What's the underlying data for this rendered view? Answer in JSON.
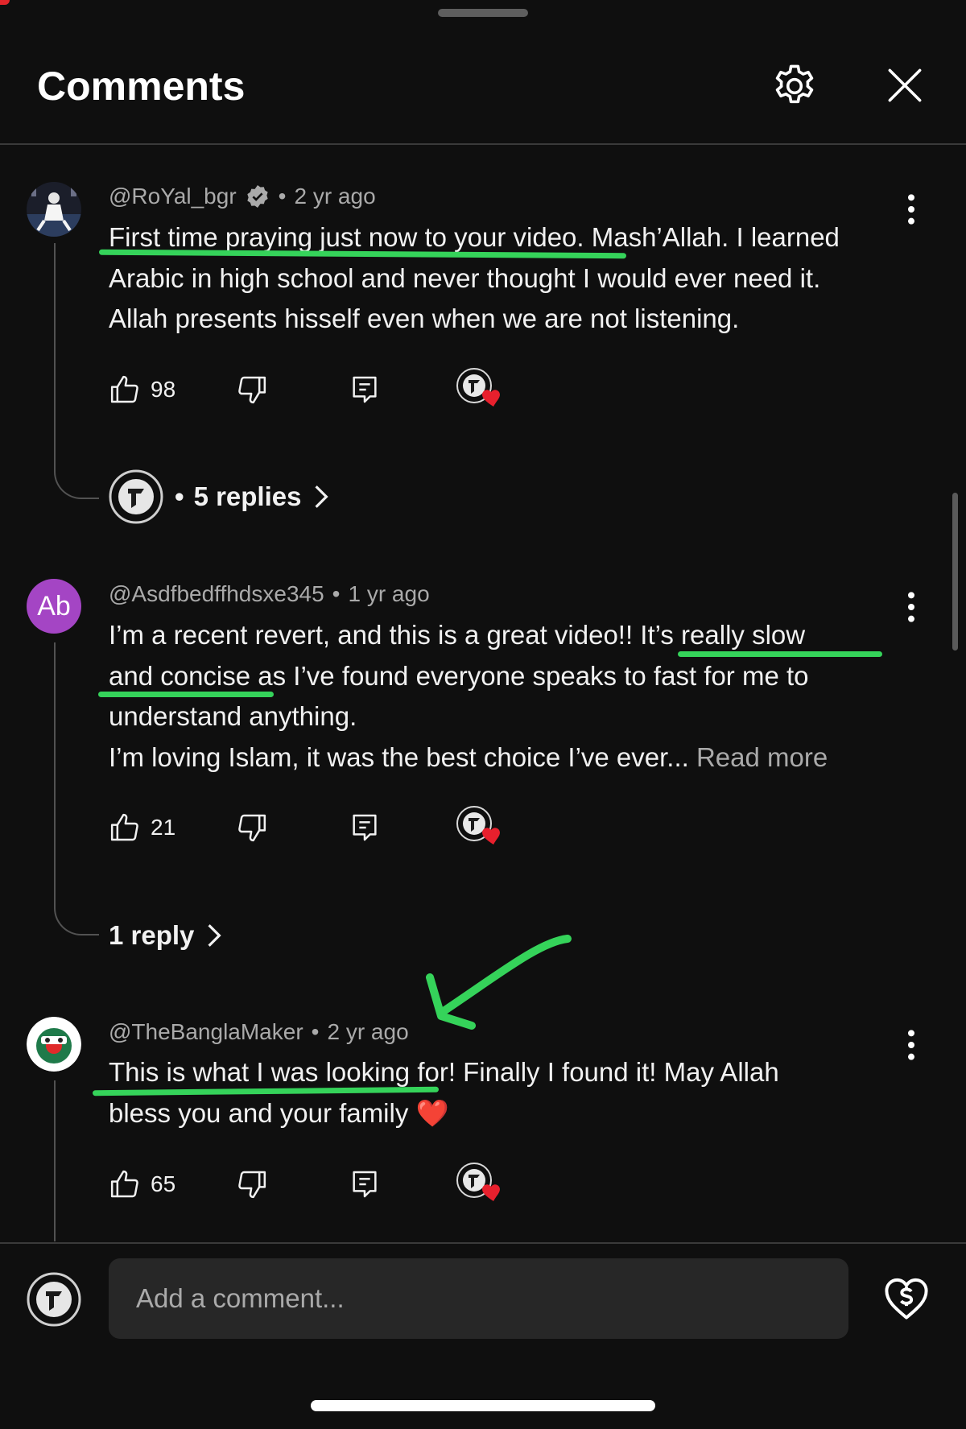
{
  "header": {
    "title": "Comments",
    "settings_icon": "gear-icon",
    "close_icon": "close-icon"
  },
  "comments": [
    {
      "handle": "@RoYal_bgr",
      "verified_icon": "verified-badge-icon",
      "time": "2 yr ago",
      "lines": [
        "First time praying just now to your video. Mash’Allah. I learned",
        "Arabic in high school and never thought I would ever need it.",
        "Allah presents hisself even when we are not listening."
      ],
      "likes": "98",
      "replies_label": "5 replies"
    },
    {
      "handle": "@Asdfbedffhdsxe345",
      "avatar_letter": "Ab",
      "avatar_color": "#a445c4",
      "time": "1 yr ago",
      "lines": [
        "I’m a recent revert, and this is a great video!! It’s really slow",
        "and concise as I’ve found everyone speaks to fast for me to",
        "understand anything.",
        "I’m loving Islam, it was the best choice I’ve ever..."
      ],
      "read_more": "Read more",
      "likes": "21",
      "replies_label": "1 reply"
    },
    {
      "handle": "@TheBanglaMaker",
      "time": "2 yr ago",
      "lines": [
        "This is what I was looking for! Finally I found it! May Allah",
        "bless you and your family"
      ],
      "emoji": "❤️",
      "likes": "65"
    }
  ],
  "composer": {
    "placeholder": "Add a comment...",
    "thanks_icon": "super-thanks-icon"
  },
  "colors": {
    "background": "#0f0f0f",
    "highlight_annotation": "#35d35a",
    "heart": "#e8202d"
  }
}
